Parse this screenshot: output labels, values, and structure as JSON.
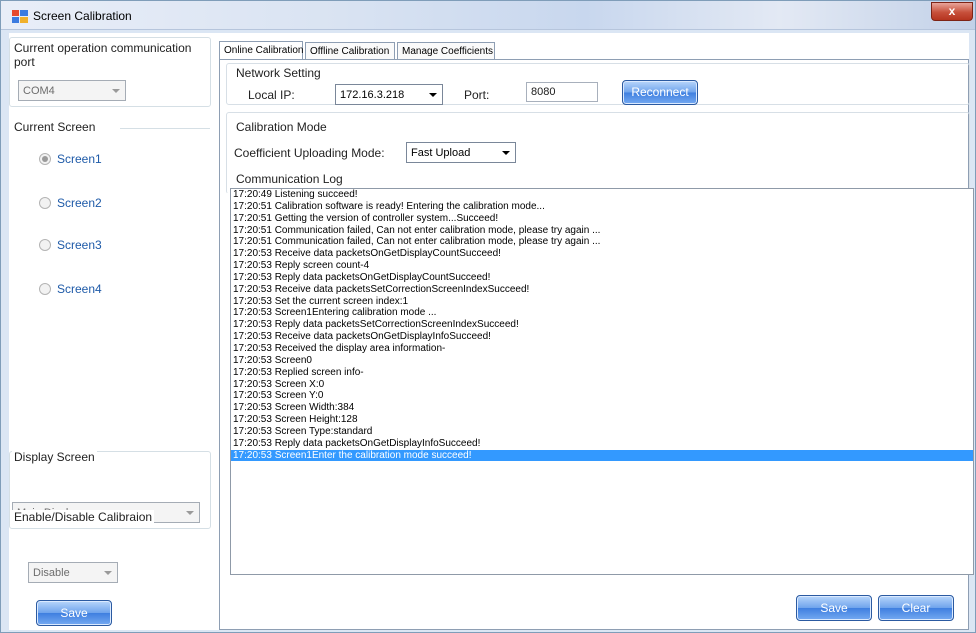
{
  "window": {
    "title": "Screen Calibration",
    "close_label": "x"
  },
  "left": {
    "port_group_title": "Current operation communication port",
    "port_value": "COM4",
    "screen_group_title": "Current Screen",
    "screens": [
      {
        "label": "Screen1",
        "checked": true
      },
      {
        "label": "Screen2",
        "checked": false
      },
      {
        "label": "Screen3",
        "checked": false
      },
      {
        "label": "Screen4",
        "checked": false
      }
    ],
    "display_group_title": "Display Screen",
    "display_value": "Main Display",
    "enable_group_title": "Enable/Disable Calibraion",
    "enable_value": "Disable",
    "save_label": "Save"
  },
  "tabs": [
    {
      "label": "Online Calibration",
      "active": true
    },
    {
      "label": "Offline Calibration",
      "active": false
    },
    {
      "label": "Manage Coefficients",
      "active": false
    }
  ],
  "network": {
    "section_title": "Network Setting",
    "local_ip_label": "Local IP:",
    "local_ip_value": "172.16.3.218",
    "port_label": "Port:",
    "port_value": "8080",
    "reconnect_label": "Reconnect"
  },
  "calibration_mode": {
    "section_title": "Calibration Mode",
    "upload_mode_label": "Coefficient Uploading Mode:",
    "upload_mode_value": "Fast Upload"
  },
  "log": {
    "section_title": "Communication Log",
    "lines": [
      "17:20:49  Listening succeed!",
      "17:20:51  Calibration software is ready! Entering the calibration mode...",
      "17:20:51  Getting the version of controller system...Succeed!",
      "17:20:51  Communication failed, Can not enter calibration mode, please try again ...",
      "17:20:51  Communication failed, Can not enter calibration mode, please try again ...",
      "17:20:53  Receive data packetsOnGetDisplayCountSucceed!",
      "17:20:53  Reply screen count-4",
      "17:20:53  Reply data packetsOnGetDisplayCountSucceed!",
      "17:20:53  Receive data packetsSetCorrectionScreenIndexSucceed!",
      "17:20:53  Set the current screen index:1",
      "17:20:53  Screen1Entering calibration mode ...",
      "17:20:53  Reply data packetsSetCorrectionScreenIndexSucceed!",
      "17:20:53  Receive data packetsOnGetDisplayInfoSucceed!",
      "17:20:53  Received the display area information-",
      "17:20:53  Screen0",
      "17:20:53  Replied screen info-",
      "17:20:53  Screen X:0",
      "17:20:53  Screen Y:0",
      "17:20:53  Screen Width:384",
      "17:20:53  Screen Height:128",
      "17:20:53  Screen Type:standard",
      "17:20:53  Reply data packetsOnGetDisplayInfoSucceed!",
      "17:20:53  Screen1Enter the calibration mode succeed!"
    ],
    "selected_index": 22
  },
  "footer": {
    "save_label": "Save",
    "clear_label": "Clear"
  },
  "colors": {
    "selection": "#3399ff",
    "button_blue": "#3f7fe0",
    "radio_label": "#1e5aa8"
  }
}
